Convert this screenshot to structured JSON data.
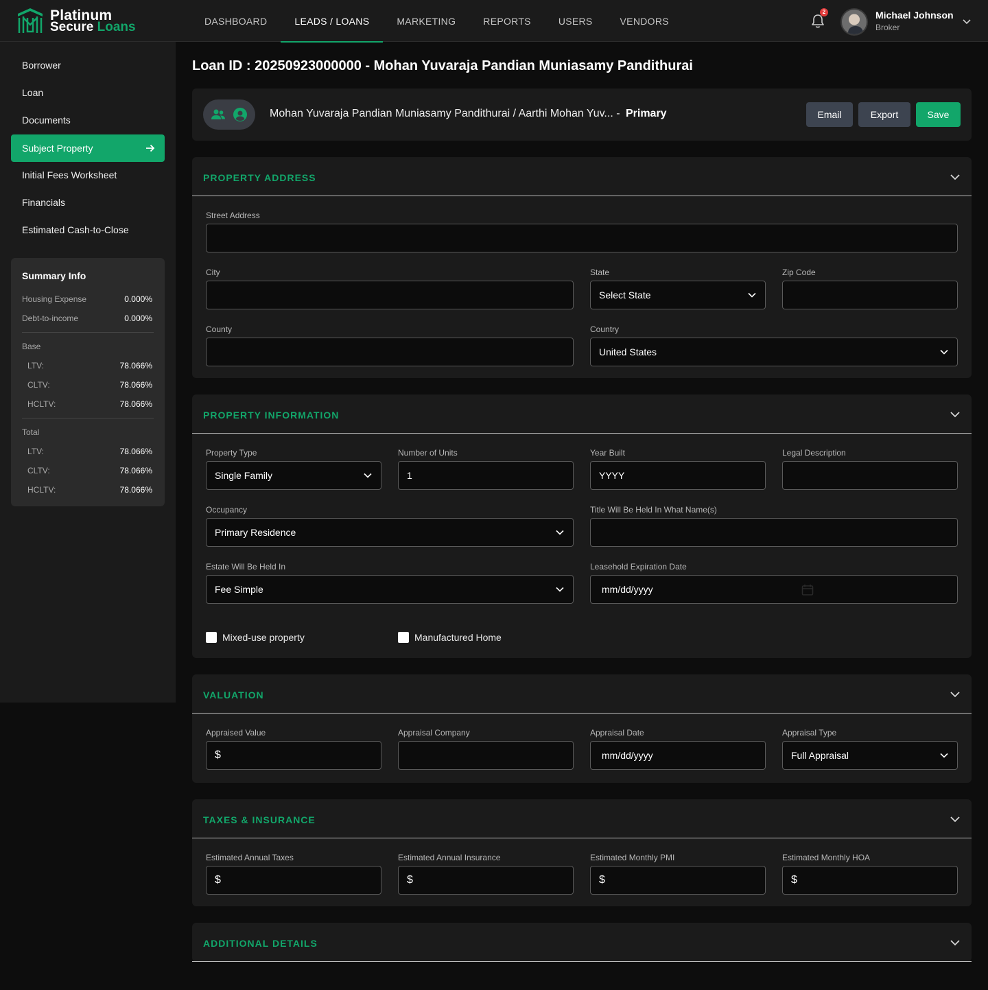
{
  "brand": {
    "line1": "Platinum",
    "line2a": "Secure",
    "line2b": "Loans"
  },
  "nav": [
    "DASHBOARD",
    "LEADS / LOANS",
    "MARKETING",
    "REPORTS",
    "USERS",
    "VENDORS"
  ],
  "notifications": {
    "count": "2"
  },
  "user": {
    "name": "Michael Johnson",
    "role": "Broker"
  },
  "sidebar": {
    "items": [
      "Borrower",
      "Loan",
      "Documents",
      "Subject Property",
      "Initial Fees Worksheet",
      "Financials",
      "Estimated Cash-to-Close"
    ],
    "active": "Subject Property"
  },
  "summary": {
    "title": "Summary Info",
    "housing_label": "Housing Expense",
    "housing_value": "0.000%",
    "dti_label": "Debt-to-income",
    "dti_value": "0.000%",
    "base_label": "Base",
    "base": [
      {
        "label": "LTV:",
        "value": "78.066%"
      },
      {
        "label": "CLTV:",
        "value": "78.066%"
      },
      {
        "label": "HCLTV:",
        "value": "78.066%"
      }
    ],
    "total_label": "Total",
    "total": [
      {
        "label": "LTV:",
        "value": "78.066%"
      },
      {
        "label": "CLTV:",
        "value": "78.066%"
      },
      {
        "label": "HCLTV:",
        "value": "78.066%"
      }
    ]
  },
  "page": {
    "title": "Loan ID : 20250923000000 - Mohan Yuvaraja Pandian Muniasamy Pandithurai"
  },
  "borrower_bar": {
    "names": "Mohan Yuvaraja Pandian Muniasamy Pandithurai / Aarthi Mohan Yuv... -",
    "primary": "Primary",
    "email": "Email",
    "export": "Export",
    "save": "Save"
  },
  "property_address": {
    "title": "PROPERTY ADDRESS",
    "street_label": "Street Address",
    "street_value": "",
    "city_label": "City",
    "city_value": "",
    "state_label": "State",
    "state_value": "Select State",
    "zip_label": "Zip Code",
    "zip_value": "",
    "county_label": "County",
    "county_value": "",
    "country_label": "Country",
    "country_value": "United States"
  },
  "property_information": {
    "title": "PROPERTY INFORMATION",
    "type_label": "Property Type",
    "type_value": "Single Family",
    "units_label": "Number of Units",
    "units_value": "1",
    "year_label": "Year Built",
    "year_placeholder": "YYYY",
    "legal_label": "Legal Description",
    "legal_value": "",
    "occupancy_label": "Occupancy",
    "occupancy_value": "Primary Residence",
    "title_names_label": "Title Will Be Held In What Name(s)",
    "title_names_value": "",
    "estate_label": "Estate Will Be Held In",
    "estate_value": "Fee Simple",
    "leasehold_label": "Leasehold Expiration Date",
    "leasehold_placeholder": "mm/dd/yyyy",
    "mixed_use_label": "Mixed-use property",
    "manufactured_label": "Manufactured Home"
  },
  "valuation": {
    "title": "VALUATION",
    "appraised_label": "Appraised Value",
    "appraised_prefix": "$",
    "company_label": "Appraisal Company",
    "company_value": "",
    "date_label": "Appraisal Date",
    "date_placeholder": "mm/dd/yyyy",
    "type_label": "Appraisal Type",
    "type_value": "Full Appraisal"
  },
  "taxes_insurance": {
    "title": "TAXES & INSURANCE",
    "taxes_label": "Estimated Annual Taxes",
    "taxes_prefix": "$",
    "insurance_label": "Estimated Annual Insurance",
    "insurance_prefix": "$",
    "pmi_label": "Estimated Monthly PMI",
    "pmi_prefix": "$",
    "hoa_label": "Estimated Monthly HOA",
    "hoa_prefix": "$"
  },
  "additional": {
    "title": "ADDITIONAL DETAILS"
  },
  "colors": {
    "accent": "#12a66a",
    "background": "#0d0d0d",
    "panel": "#1b1b1b",
    "button_gray": "#3d4450"
  }
}
